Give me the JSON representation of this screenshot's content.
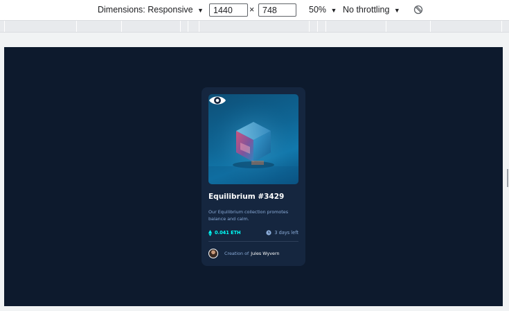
{
  "devtools": {
    "dimensions_label": "Dimensions: Responsive",
    "width_value": "1440",
    "times": "×",
    "height_value": "748",
    "zoom": "50%",
    "throttling": "No throttling",
    "dropdown_arrow": "▼"
  },
  "card": {
    "title": "Equilibrium #3429",
    "description": "Our Equilibrium collection promotes balance and calm.",
    "price": "0.041 ETH",
    "time_left": "3 days left",
    "creator_prefix": "Creation of",
    "creator_name": "Jules Wyvern"
  },
  "colors": {
    "background": "#0d1a2d",
    "card": "#15263f",
    "accent": "#00fff8",
    "muted_text": "#8bacd9"
  }
}
